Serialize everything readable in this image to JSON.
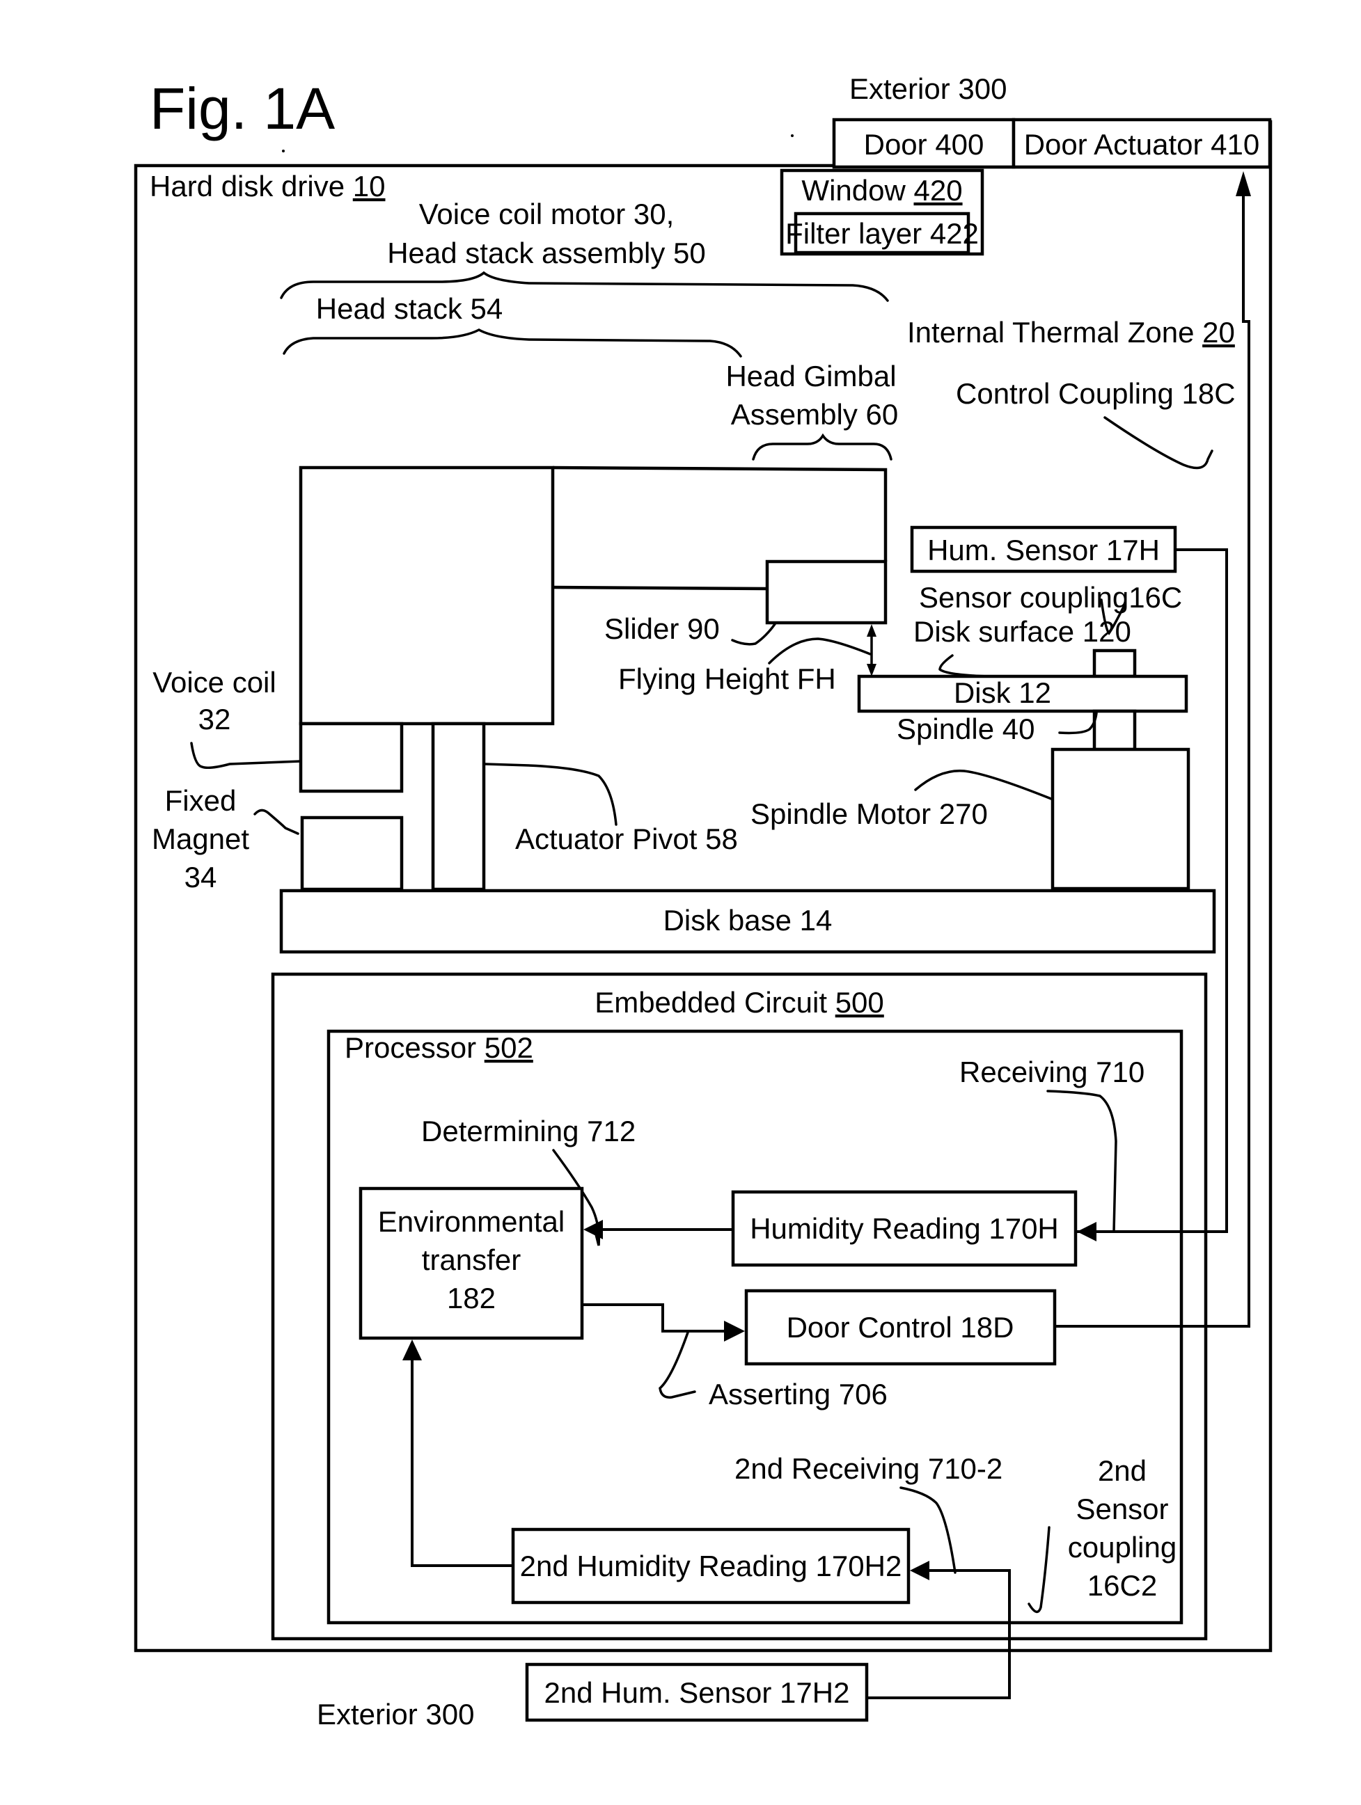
{
  "figure": {
    "title": "Fig. 1A",
    "exterior_top": "Exterior 300",
    "exterior_bottom": "Exterior 300"
  },
  "door": {
    "door": "Door 400",
    "actuator": "Door Actuator 410",
    "window_prefix": "Window ",
    "window_ref": "420",
    "filter": "Filter layer 422"
  },
  "hdd": {
    "label_prefix": "Hard disk drive ",
    "label_ref": "10",
    "vcm_line1": "Voice coil motor 30,",
    "vcm_line2": "Head stack assembly 50",
    "head_stack": "Head stack 54",
    "hga_line1": "Head Gimbal",
    "hga_line2": "Assembly 60",
    "thermal_prefix": "Internal Thermal Zone ",
    "thermal_ref": "20",
    "control_coupling": "Control Coupling 18C",
    "hum_sensor": "Hum. Sensor 17H",
    "sensor_coupling": "Sensor coupling16C",
    "disk_surface": "Disk surface 120",
    "slider": "Slider 90",
    "flying_height": "Flying Height FH",
    "disk": "Disk 12",
    "spindle": "Spindle 40",
    "spindle_motor": "Spindle Motor 270",
    "voice_coil_line1": "Voice coil",
    "voice_coil_line2": "32",
    "magnet_line1": "Fixed",
    "magnet_line2": "Magnet",
    "magnet_line3": "34",
    "actuator_pivot": "Actuator Pivot 58",
    "disk_base": "Disk base 14"
  },
  "circuit": {
    "embedded_prefix": "Embedded Circuit ",
    "embedded_ref": "500",
    "processor_prefix": "Processor ",
    "processor_ref": "502",
    "receiving": "Receiving 710",
    "determining": "Determining 712",
    "env_line1": "Environmental",
    "env_line2": "transfer",
    "env_line3": "182",
    "humidity_reading": "Humidity Reading 170H",
    "door_control": "Door Control 18D",
    "asserting": "Asserting 706",
    "second_receiving": "2nd Receiving 710-2",
    "second_coupling_line1": "2nd",
    "second_coupling_line2": "Sensor",
    "second_coupling_line3": "coupling",
    "second_coupling_line4": "16C2",
    "second_humidity_reading": "2nd Humidity Reading 170H2",
    "second_hum_sensor": "2nd Hum. Sensor 17H2"
  }
}
